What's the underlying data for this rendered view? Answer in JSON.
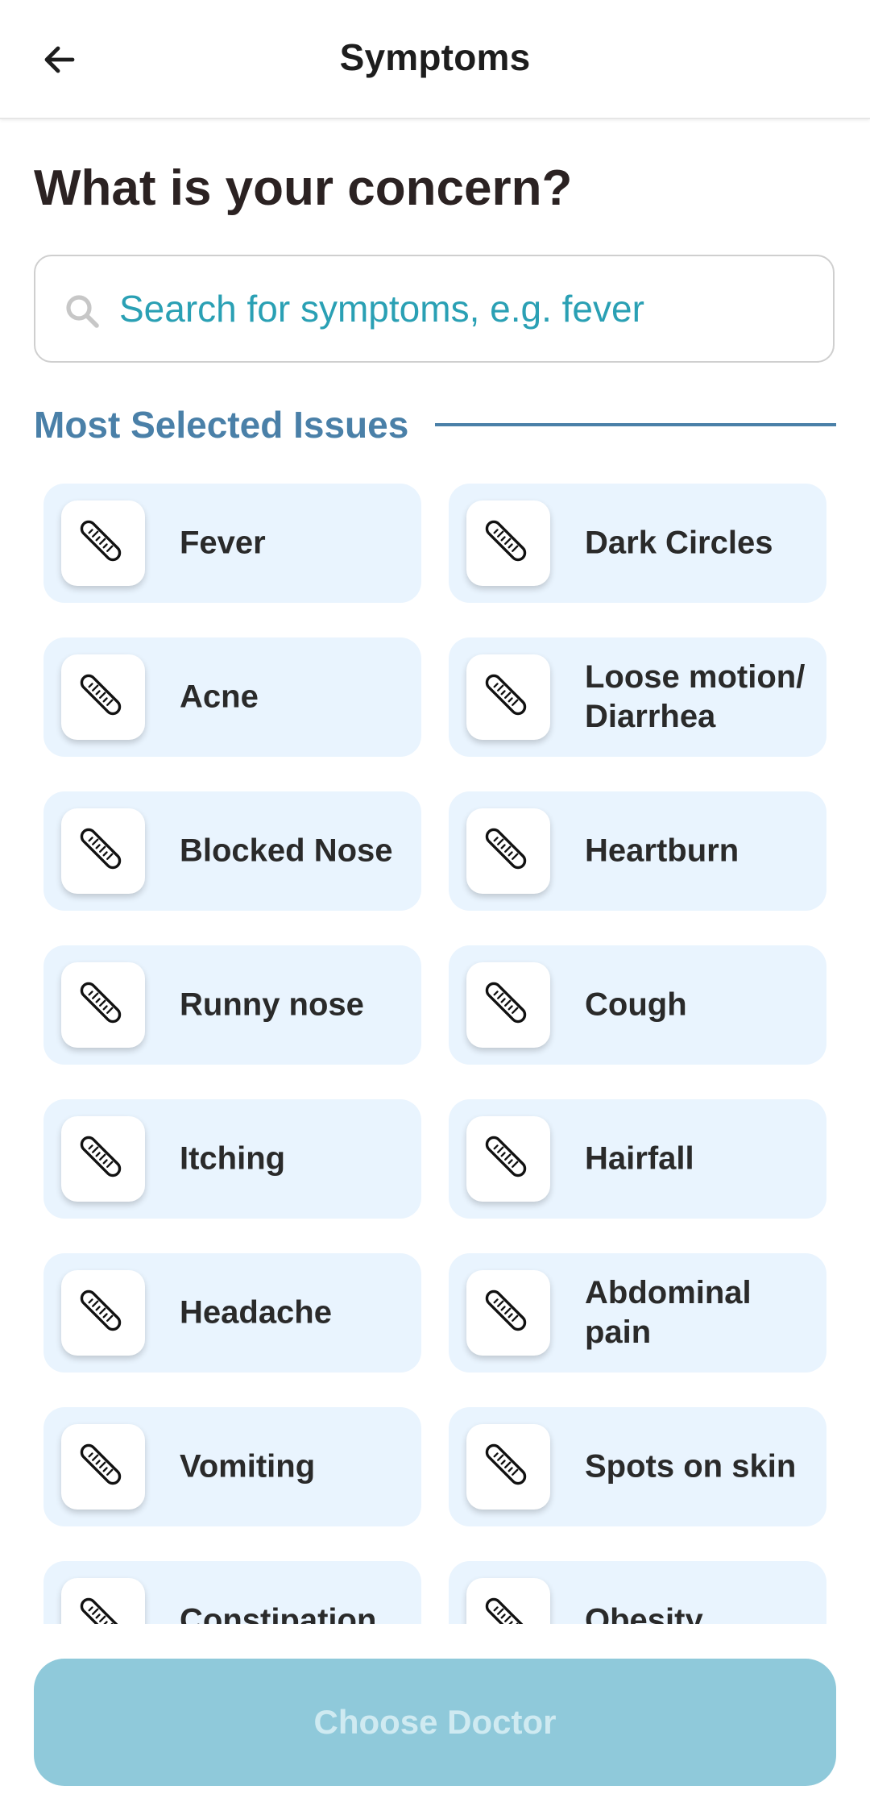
{
  "app_bar": {
    "title": "Symptoms",
    "back_icon": "arrow-left-icon"
  },
  "heading": "What is your concern?",
  "search": {
    "placeholder": "Search for symptoms, e.g. fever",
    "value": "",
    "icon": "search-icon"
  },
  "section": {
    "title": "Most Selected Issues"
  },
  "symptoms": [
    {
      "label": "Fever",
      "icon": "thermometer-icon"
    },
    {
      "label": "Dark Circles",
      "icon": "thermometer-icon"
    },
    {
      "label": "Acne",
      "icon": "thermometer-icon"
    },
    {
      "label": "Loose motion/ Diarrhea",
      "icon": "thermometer-icon"
    },
    {
      "label": "Blocked Nose",
      "icon": "thermometer-icon"
    },
    {
      "label": "Heartburn",
      "icon": "thermometer-icon"
    },
    {
      "label": "Runny nose",
      "icon": "thermometer-icon"
    },
    {
      "label": "Cough",
      "icon": "thermometer-icon"
    },
    {
      "label": "Itching",
      "icon": "thermometer-icon"
    },
    {
      "label": "Hairfall",
      "icon": "thermometer-icon"
    },
    {
      "label": "Headache",
      "icon": "thermometer-icon"
    },
    {
      "label": "Abdominal pain",
      "icon": "thermometer-icon"
    },
    {
      "label": "Vomiting",
      "icon": "thermometer-icon"
    },
    {
      "label": "Spots on skin",
      "icon": "thermometer-icon"
    },
    {
      "label": "Constipation",
      "icon": "thermometer-icon"
    },
    {
      "label": "Obesity",
      "icon": "thermometer-icon"
    }
  ],
  "footer": {
    "choose_doctor_label": "Choose Doctor",
    "enabled": false
  },
  "colors": {
    "card_bg": "#e9f4fe",
    "section_accent": "#4a80a8",
    "search_text": "#2aa0b4",
    "button_disabled_bg": "#8fc9da",
    "button_disabled_text": "#cfeaf1"
  }
}
